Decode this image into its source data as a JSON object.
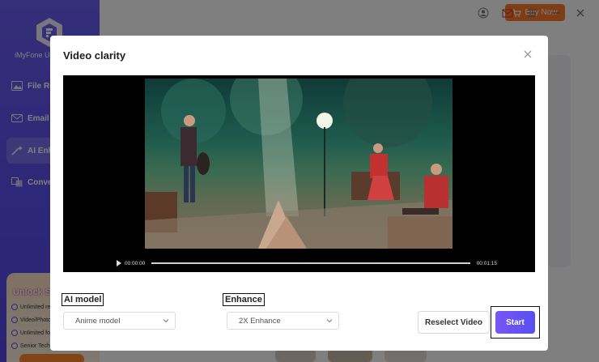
{
  "app": {
    "brand": "iMyFone U",
    "nav": [
      {
        "label": "File Re",
        "icon": "image-icon"
      },
      {
        "label": "Email",
        "icon": "mail-icon"
      },
      {
        "label": "AI Enha",
        "icon": "magic-wand-icon"
      },
      {
        "label": "Conve",
        "icon": "convert-icon"
      }
    ],
    "buy_label": "Buy Now",
    "promo": {
      "title": "Unlock SVIP",
      "lines": [
        "Unlimited rep",
        "Video/Photo",
        "Unlimited fo",
        "Senior Techn"
      ]
    }
  },
  "dialog": {
    "title": "Video clarity",
    "video": {
      "current_time": "00:00:00",
      "total_time": "00:01:15",
      "progress": 0
    },
    "ai_model": {
      "label": "AI model",
      "value": "Anime model"
    },
    "enhance": {
      "label": "Enhance",
      "value": "2X Enhance"
    },
    "reselect_label": "Reselect Video",
    "start_label": "Start"
  },
  "colors": {
    "accent": "#6a55f2",
    "buy": "#ff7a2a"
  }
}
